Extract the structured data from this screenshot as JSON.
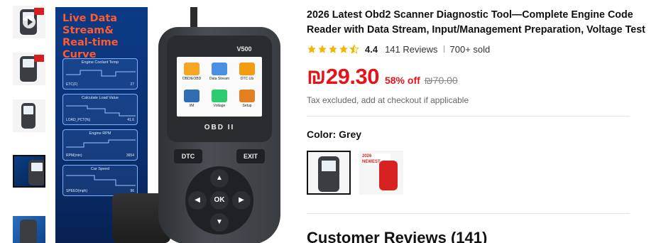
{
  "product": {
    "title": "2026 Latest Obd2 Scanner Diagnostic Tool—Complete Engine Code Reader with Data Stream, Input/Management Preparation, Voltage Test",
    "rating": "4.4",
    "rating_value": 4.4,
    "reviews": "141 Reviews",
    "sold": "700+ sold",
    "price": "₪29.30",
    "discount": "58% off",
    "original_price": "₪70.00",
    "tax_note": "Tax excluded, add at checkout if applicable",
    "color_label": "Color: Grey",
    "customer_reviews": "Customer Reviews (141)"
  },
  "image": {
    "promo_title": "Live Data Stream& Real-time Curve",
    "panels": [
      {
        "title": "Engine Coolant Temp",
        "label": "ETC(F)",
        "value": "27"
      },
      {
        "title": "Calculate Load Value",
        "label": "LOAD_PCT(%)",
        "value": "41.6"
      },
      {
        "title": "Engine RPM",
        "label": "RPM(min)",
        "value": "3654"
      },
      {
        "title": "Car Speed",
        "label": "SPEED(mph)",
        "value": "96"
      }
    ],
    "device_model": "V500",
    "apps": [
      {
        "label": "OBD/EOBD",
        "color": "#f5a623"
      },
      {
        "label": "Data Stream",
        "color": "#4a90e2"
      },
      {
        "label": "DTC Lib",
        "color": "#f39c12"
      },
      {
        "label": "I/M",
        "color": "#2f6db5"
      },
      {
        "label": "Voltage",
        "color": "#2ecc71"
      },
      {
        "label": "Setup",
        "color": "#e67e22"
      }
    ],
    "obd_label": "OBD II",
    "btn_dtc": "DTC",
    "btn_exit": "EXIT",
    "btn_ok": "OK",
    "btn_up": "▲",
    "btn_down": "▼",
    "btn_left": "◀",
    "btn_right": "▶"
  },
  "swatch_banner": "2026 NEWEST",
  "colors": {
    "price_red": "#e4141b",
    "star": "#f5b400",
    "promo_blue": "#0b3b86",
    "promo_orange": "#ff5a30"
  }
}
